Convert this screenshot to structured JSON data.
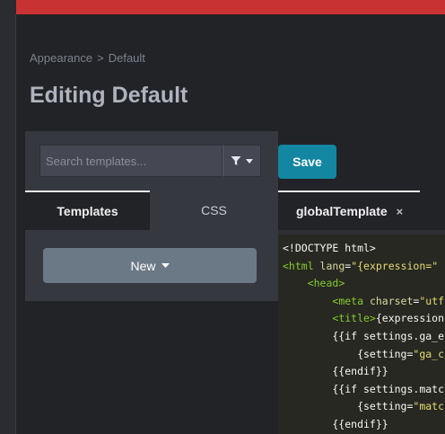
{
  "colors": {
    "topbar": "#c93232",
    "save_button": "#1386a1",
    "new_button": "#6b7886",
    "code_background": "#272822"
  },
  "breadcrumb": {
    "items": [
      "Appearance",
      "Default"
    ],
    "separator": ">"
  },
  "page": {
    "title": "Editing Default"
  },
  "search": {
    "placeholder": "Search templates...",
    "value": ""
  },
  "filter": {
    "icon": "filter-icon",
    "dropdown_icon": "caret-down-icon"
  },
  "tabs": [
    {
      "label": "Templates",
      "active": true
    },
    {
      "label": "CSS",
      "active": false
    }
  ],
  "new_button": {
    "label": "New",
    "icon": "caret-down-icon"
  },
  "save_button": {
    "label": "Save"
  },
  "editor_tab": {
    "label": "globalTemplate",
    "close_glyph": "×"
  },
  "code_lines": [
    [
      {
        "t": "<!DOCTYPE html>",
        "c": "plain"
      }
    ],
    [
      {
        "t": "<html ",
        "c": "tag"
      },
      {
        "t": "lang",
        "c": "attr"
      },
      {
        "t": "=",
        "c": "plain"
      },
      {
        "t": "\"{expression=\"",
        "c": "str"
      }
    ],
    [
      {
        "t": "    ",
        "c": "plain"
      },
      {
        "t": "<head>",
        "c": "tag"
      }
    ],
    [
      {
        "t": "        ",
        "c": "plain"
      },
      {
        "t": "<meta ",
        "c": "tag"
      },
      {
        "t": "charset",
        "c": "attr"
      },
      {
        "t": "=",
        "c": "plain"
      },
      {
        "t": "\"utf",
        "c": "str"
      }
    ],
    [
      {
        "t": "        ",
        "c": "plain"
      },
      {
        "t": "<title>",
        "c": "tag"
      },
      {
        "t": "{expression",
        "c": "plain"
      }
    ],
    [
      {
        "t": "        {{if settings.ga_e",
        "c": "plain"
      }
    ],
    [
      {
        "t": "            {setting=",
        "c": "plain"
      },
      {
        "t": "\"ga_c",
        "c": "str"
      }
    ],
    [
      {
        "t": "        {{endif}}",
        "c": "plain"
      }
    ],
    [
      {
        "t": "        {{if settings.matc",
        "c": "plain"
      }
    ],
    [
      {
        "t": "            {setting=",
        "c": "plain"
      },
      {
        "t": "\"matc",
        "c": "str"
      }
    ],
    [
      {
        "t": "        {{endif}}",
        "c": "plain"
      }
    ]
  ]
}
